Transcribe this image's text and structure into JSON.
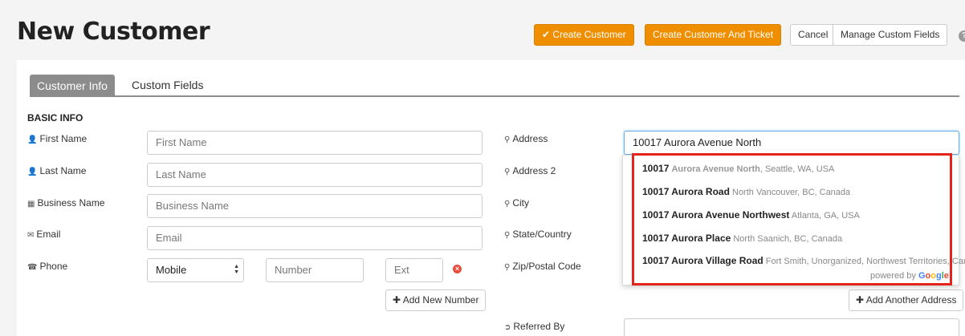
{
  "page": {
    "title": "New Customer"
  },
  "toolbar": {
    "create_customer": "Create Customer",
    "create_customer_ticket": "Create Customer And Ticket",
    "cancel": "Cancel",
    "manage_custom_fields": "Manage Custom Fields",
    "help": "?"
  },
  "tabs": [
    {
      "label": "Customer Info",
      "active": true
    },
    {
      "label": "Custom Fields",
      "active": false
    }
  ],
  "basic_info": {
    "heading": "BASIC INFO",
    "first_name": {
      "label": "First Name",
      "placeholder": "First Name"
    },
    "last_name": {
      "label": "Last Name",
      "placeholder": "Last Name"
    },
    "business_name": {
      "label": "Business Name",
      "placeholder": "Business Name"
    },
    "email": {
      "label": "Email",
      "placeholder": "Email"
    },
    "phone": {
      "label": "Phone",
      "type_value": "Mobile",
      "number_placeholder": "Number",
      "ext_placeholder": "Ext",
      "add_number": "Add New Number"
    }
  },
  "address": {
    "address_label": "Address",
    "address_value": "10017 Aurora Avenue North",
    "address2_label": "Address 2",
    "city_label": "City",
    "state_label": "State/Country",
    "zip_label": "Zip/Postal Code",
    "add_address": "Add Another Address",
    "referred_label": "Referred By"
  },
  "autocomplete": {
    "suggestions": [
      {
        "main": "10017",
        "match": "Aurora Avenue North",
        "rest": ", Seattle, WA, USA"
      },
      {
        "main": "10017 Aurora Road",
        "match": "",
        "rest": " North Vancouver, BC, Canada"
      },
      {
        "main": "10017 Aurora Avenue Northwest",
        "match": "",
        "rest": " Atlanta, GA, USA"
      },
      {
        "main": "10017 Aurora Place",
        "match": "",
        "rest": " North Saanich, BC, Canada"
      },
      {
        "main": "10017 Aurora Village Road",
        "match": "",
        "rest": " Fort Smith, Unorganized, Northwest Territories, Can..."
      }
    ],
    "powered_by": "powered by",
    "google": [
      "G",
      "o",
      "o",
      "g",
      "l",
      "e"
    ]
  },
  "colors": {
    "accent": "#ef8f00",
    "tab_active": "#8c8c8c",
    "highlight": "#e5231b",
    "focus": "#66afe9"
  },
  "icons": {
    "check": "check-circle-icon",
    "user": "user-icon",
    "building": "building-icon",
    "envelope": "envelope-icon",
    "phone": "phone-icon",
    "marker": "map-marker-icon",
    "referral": "arrow-circle-icon",
    "plus": "plus-icon",
    "remove": "remove-icon"
  }
}
